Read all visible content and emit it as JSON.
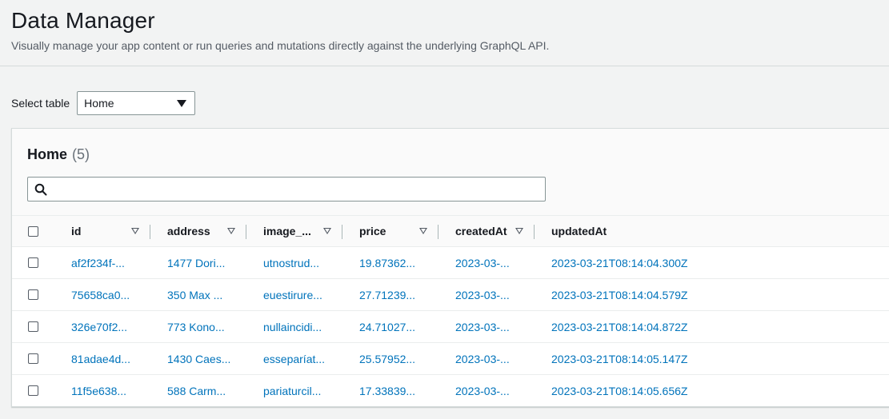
{
  "header": {
    "title": "Data Manager",
    "description": "Visually manage your app content or run queries and mutations directly against the underlying GraphQL API."
  },
  "select_table": {
    "label": "Select table",
    "value": "Home"
  },
  "table_panel": {
    "title": "Home",
    "count": "(5)",
    "search_placeholder": "",
    "columns": [
      "id",
      "address",
      "image_...",
      "price",
      "createdAt",
      "updatedAt"
    ],
    "rows": [
      [
        "af2f234f-...",
        "1477 Dori...",
        "utnostrud...",
        "19.87362...",
        "2023-03-...",
        "2023-03-21T08:14:04.300Z"
      ],
      [
        "75658ca0...",
        "350 Max ...",
        "euestirure...",
        "27.71239...",
        "2023-03-...",
        "2023-03-21T08:14:04.579Z"
      ],
      [
        "326e70f2...",
        "773 Kono...",
        "nullaincidi...",
        "24.71027...",
        "2023-03-...",
        "2023-03-21T08:14:04.872Z"
      ],
      [
        "81adae4d...",
        "1430 Caes...",
        "esseparíat...",
        "25.57952...",
        "2023-03-...",
        "2023-03-21T08:14:05.147Z"
      ],
      [
        "11f5e638...",
        "588 Carm...",
        "pariaturcil...",
        "17.33839...",
        "2023-03-...",
        "2023-03-21T08:14:05.656Z"
      ]
    ]
  },
  "colors": {
    "link": "#0073bb",
    "background": "#f2f3f3",
    "panel": "#ffffff"
  }
}
